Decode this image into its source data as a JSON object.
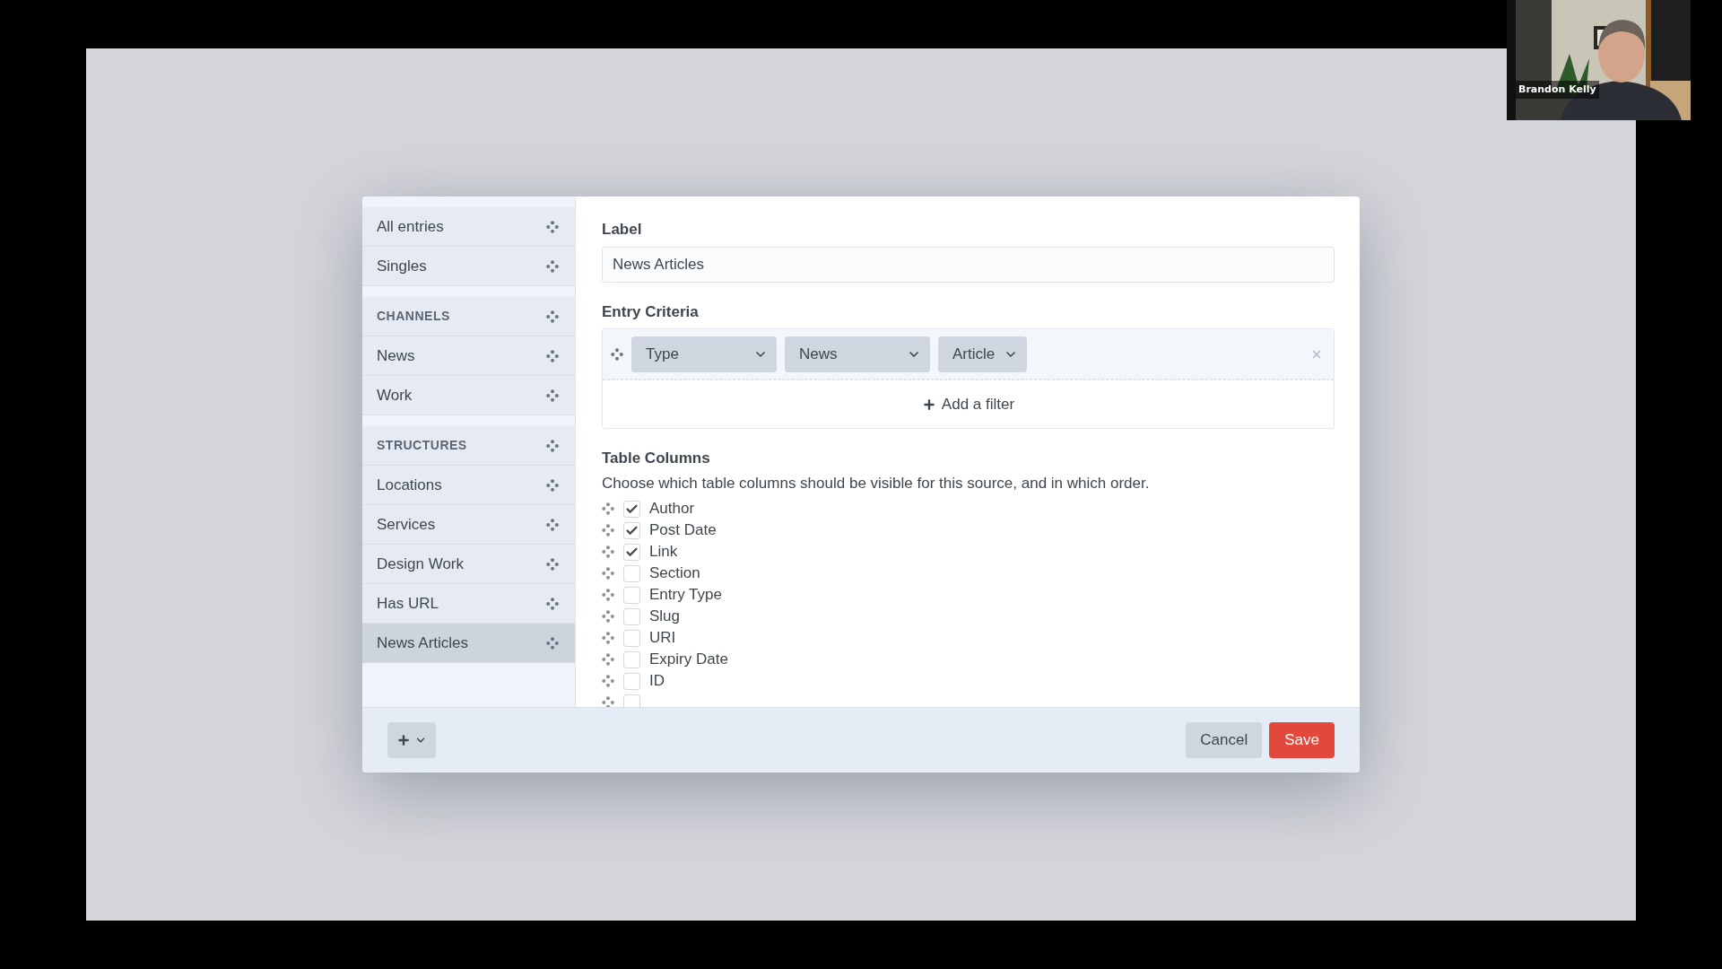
{
  "sidebar": {
    "groups": [
      {
        "items": [
          {
            "kind": "item",
            "label": "All entries",
            "selected": false
          },
          {
            "kind": "item",
            "label": "Singles",
            "selected": false
          }
        ]
      },
      {
        "items": [
          {
            "kind": "heading",
            "label": "CHANNELS",
            "selected": false
          },
          {
            "kind": "item",
            "label": "News",
            "selected": false
          },
          {
            "kind": "item",
            "label": "Work",
            "selected": false
          }
        ]
      },
      {
        "items": [
          {
            "kind": "heading",
            "label": "STRUCTURES",
            "selected": false
          },
          {
            "kind": "item",
            "label": "Locations",
            "selected": false
          },
          {
            "kind": "item",
            "label": "Services",
            "selected": false
          },
          {
            "kind": "item",
            "label": "Design Work",
            "selected": false
          },
          {
            "kind": "item",
            "label": "Has URL",
            "selected": false
          },
          {
            "kind": "item",
            "label": "News Articles",
            "selected": true
          }
        ]
      }
    ]
  },
  "label_field": {
    "label": "Label",
    "value": "News Articles"
  },
  "entry_criteria": {
    "title": "Entry Criteria",
    "filters": [
      {
        "value": "Type"
      },
      {
        "value": "News"
      },
      {
        "value": "Article"
      }
    ],
    "add_filter": "Add a filter"
  },
  "table_columns": {
    "title": "Table Columns",
    "description": "Choose which table columns should be visible for this source, and in which order.",
    "columns": [
      {
        "label": "Author",
        "checked": true
      },
      {
        "label": "Post Date",
        "checked": true
      },
      {
        "label": "Link",
        "checked": true
      },
      {
        "label": "Section",
        "checked": false
      },
      {
        "label": "Entry Type",
        "checked": false
      },
      {
        "label": "Slug",
        "checked": false
      },
      {
        "label": "URI",
        "checked": false
      },
      {
        "label": "Expiry Date",
        "checked": false
      },
      {
        "label": "ID",
        "checked": false
      },
      {
        "checked": false
      }
    ]
  },
  "footer": {
    "cancel": "Cancel",
    "save": "Save"
  },
  "webcam": {
    "name": "Brandon Kelly"
  }
}
